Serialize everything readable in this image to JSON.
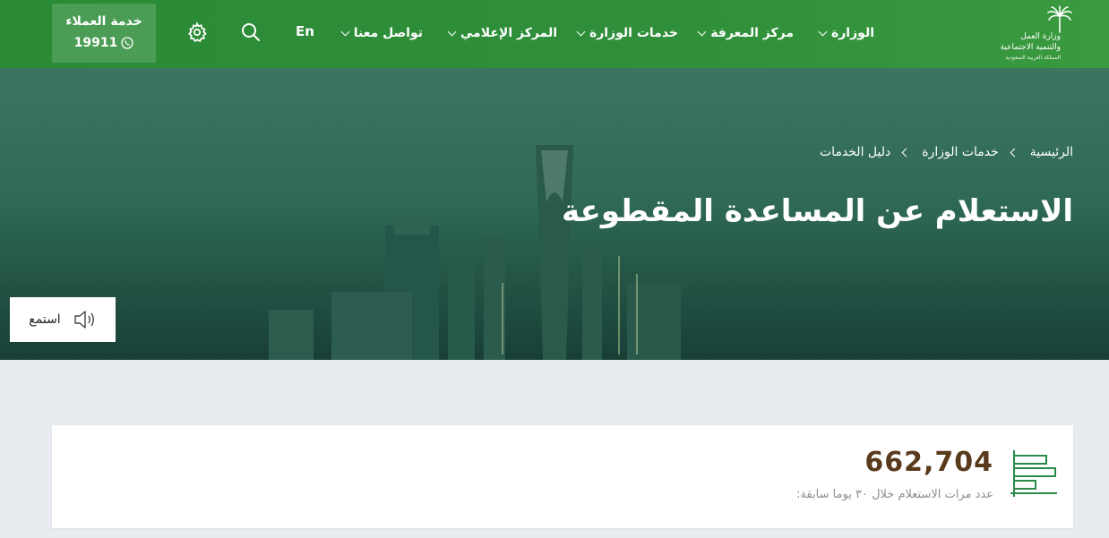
{
  "header": {
    "logo_lines": [
      "وزارة العمل",
      "والتنمية الاجتماعية",
      "المملكة العربية السعودية"
    ],
    "nav": [
      {
        "label": "الوزارة"
      },
      {
        "label": "مركز المعرفة"
      },
      {
        "label": "خدمات الوزارة"
      },
      {
        "label": "المركز الإعلامي"
      },
      {
        "label": "تواصل معنا"
      }
    ],
    "lang_label": "En",
    "search_icon": "search-icon",
    "settings_icon": "gear-icon",
    "customer_service": {
      "title": "خدمة العملاء",
      "phone": "19911",
      "icon": "phone-icon"
    }
  },
  "hero": {
    "breadcrumbs": [
      "الرئيسية",
      "خدمات الوزارة",
      "دليل الخدمات"
    ],
    "title": "الاستعلام عن المساعدة المقطوعة",
    "listen_label": "استمع",
    "listen_icon": "speaker-icon"
  },
  "stats": {
    "value": "662,704",
    "label": "عدد مرات الاستعلام خلال ٣٠ يوما سابقة:",
    "icon": "bar-chart-icon"
  },
  "colors": {
    "header_green": "#2f8f3a",
    "customer_box": "#4b9c55",
    "stat_value": "#5a3a1c",
    "page_bg": "#e8ecf0"
  }
}
